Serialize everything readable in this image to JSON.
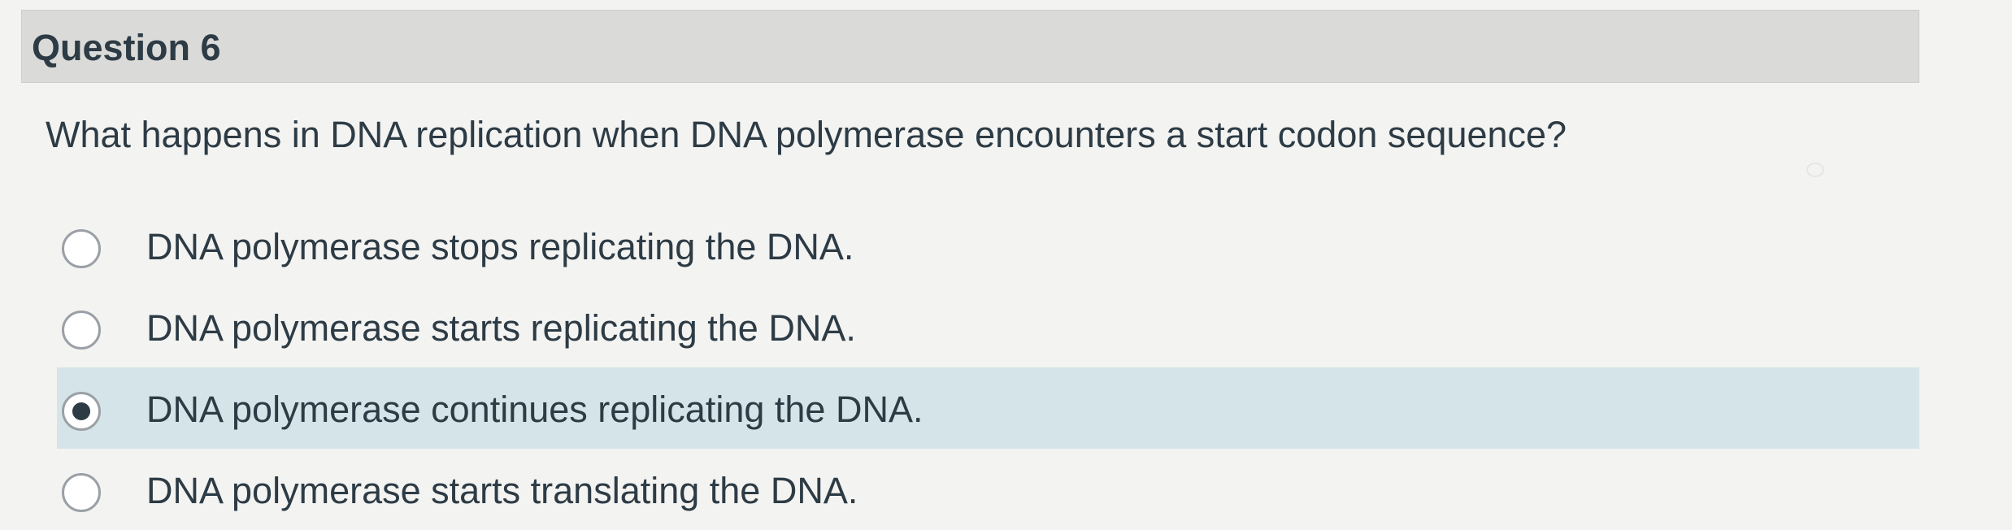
{
  "question": {
    "title": "Question 6",
    "text": "What happens in DNA replication when DNA polymerase encounters a start codon sequence?"
  },
  "answers": [
    {
      "label": "DNA polymerase stops replicating the DNA.",
      "selected": false
    },
    {
      "label": "DNA polymerase starts replicating the DNA.",
      "selected": false
    },
    {
      "label": "DNA polymerase continues replicating the DNA.",
      "selected": true
    },
    {
      "label": "DNA polymerase starts translating the DNA.",
      "selected": false
    }
  ],
  "colors": {
    "page_background": "#f3f3f1",
    "header_background": "#dadad8",
    "selected_background": "#d5e4e8",
    "text": "#2d3b45"
  }
}
